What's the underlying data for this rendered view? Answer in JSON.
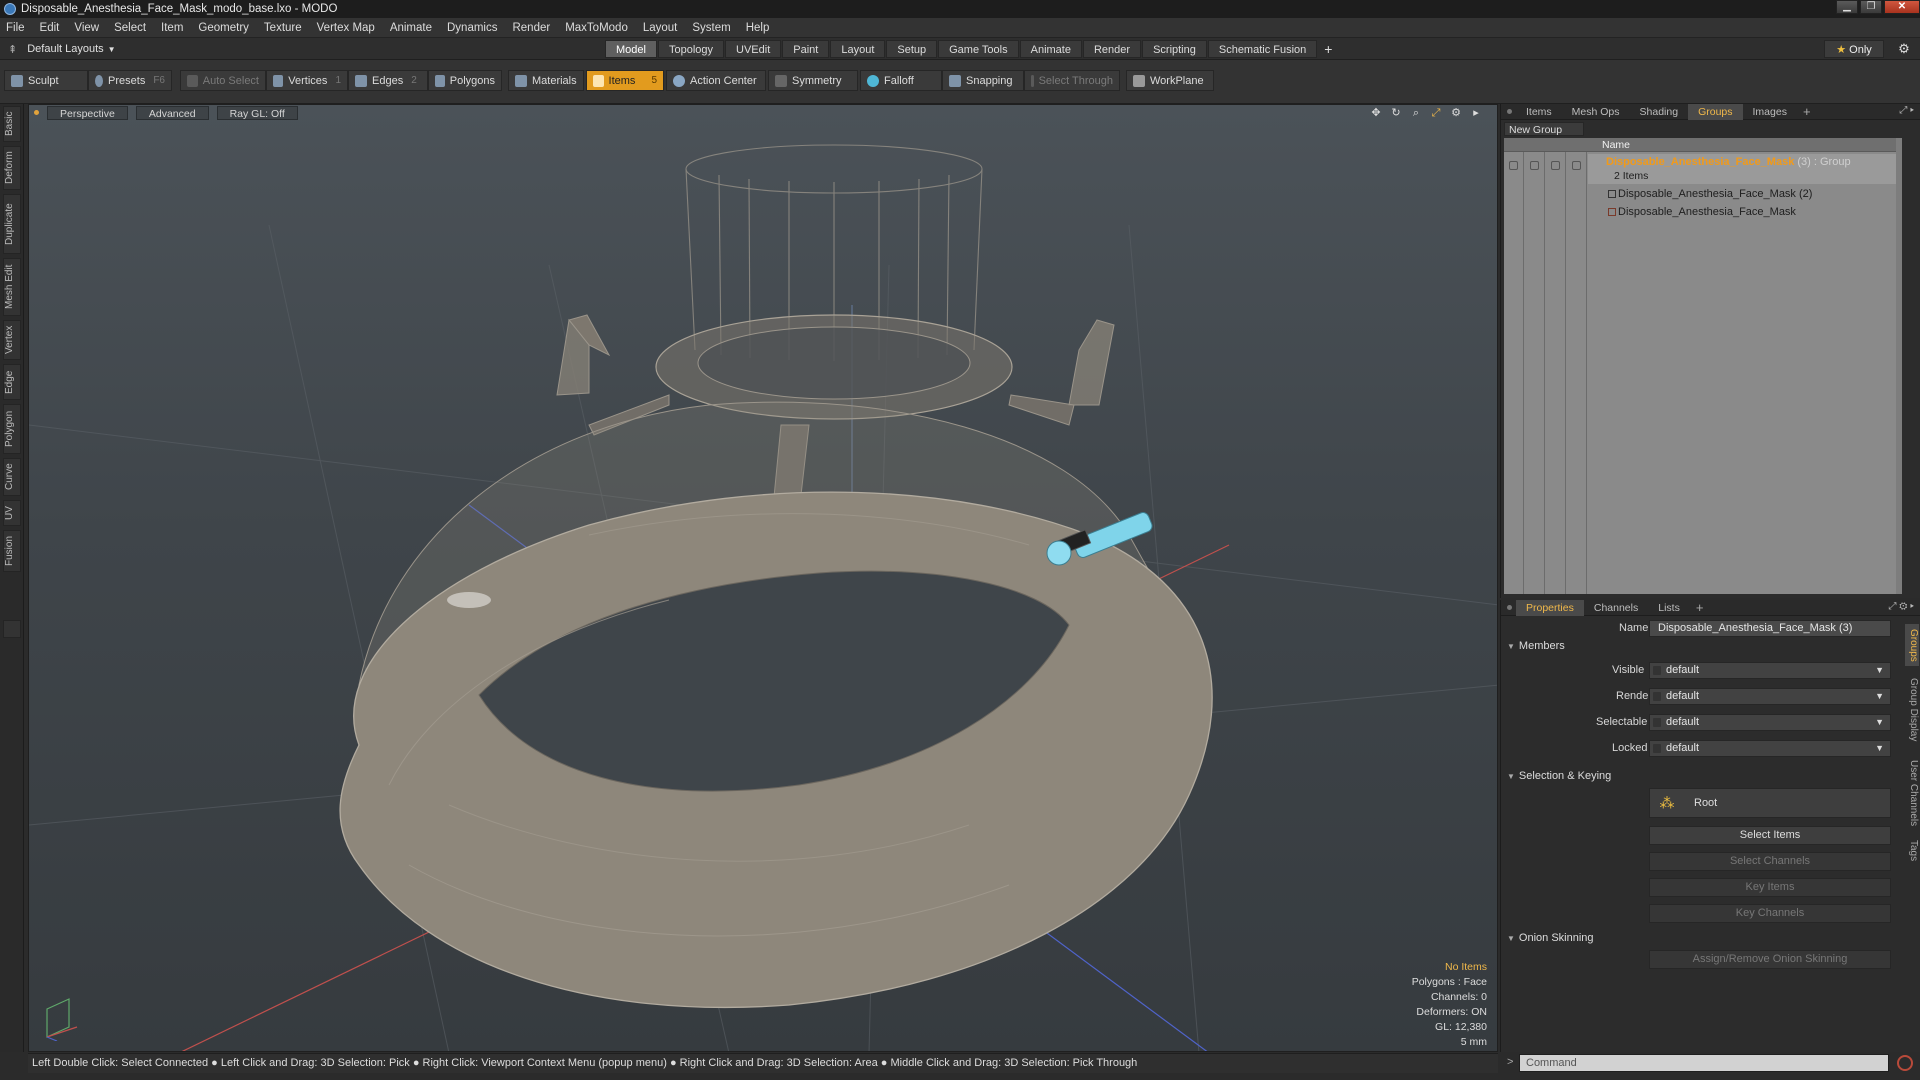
{
  "window": {
    "title": "Disposable_Anesthesia_Face_Mask_modo_base.lxo - MODO",
    "buttons": [
      "▁",
      "❐",
      "✕"
    ]
  },
  "menubar": [
    "File",
    "Edit",
    "View",
    "Select",
    "Item",
    "Geometry",
    "Texture",
    "Vertex Map",
    "Animate",
    "Dynamics",
    "Render",
    "MaxToModo",
    "Layout",
    "System",
    "Help"
  ],
  "modebar": {
    "layout_selector": "Default Layouts",
    "tabs": [
      "Model",
      "Topology",
      "UVEdit",
      "Paint",
      "Layout",
      "Setup",
      "Game Tools",
      "Animate",
      "Render",
      "Scripting",
      "Schematic Fusion"
    ],
    "active_tab": "Model",
    "add_tab": "+",
    "only_label": "Only",
    "only_star": "★"
  },
  "toolbar": {
    "sculpt": "Sculpt",
    "presets": "Presets",
    "presets_key": "F6",
    "auto_select": "Auto Select",
    "vertices": "Vertices",
    "vertices_count": "1",
    "edges": "Edges",
    "edges_count": "2",
    "polygons": "Polygons",
    "materials": "Materials",
    "items": "Items",
    "items_count": "5",
    "action_center": "Action Center",
    "symmetry": "Symmetry",
    "falloff": "Falloff",
    "snapping": "Snapping",
    "select_through": "Select Through",
    "workplane": "WorkPlane"
  },
  "left_tabs": [
    "Basic",
    "Deform",
    "Duplicate",
    "Mesh Edit",
    "Vertex",
    "Edge",
    "Polygon",
    "Curve",
    "UV",
    "Fusion"
  ],
  "viewport": {
    "view_mode": "Perspective",
    "advanced": "Advanced",
    "raygl": "Ray GL: Off",
    "stats": {
      "no_items": "No Items",
      "polygons": "Polygons : Face",
      "channels": "Channels: 0",
      "deformers": "Deformers: ON",
      "gl": "GL: 12,380",
      "unit": "5 mm"
    }
  },
  "statusbar": "Left Double Click: Select Connected ● Left Click and Drag: 3D Selection: Pick ● Right Click: Viewport Context Menu (popup menu) ● Right Click and Drag: 3D Selection: Area ● Middle Click and Drag: 3D Selection: Pick Through",
  "top_panel": {
    "tabs": [
      "Items",
      "Mesh Ops",
      "Shading",
      "Groups",
      "Images"
    ],
    "active_tab": "Groups",
    "add": "+",
    "new_group": "New Group",
    "name_header": "Name",
    "group": {
      "name": "Disposable_Anesthesia_Face_Mask",
      "count": " (3)",
      "type": " : Group",
      "items_label": "2 Items"
    },
    "items": [
      "Disposable_Anesthesia_Face_Mask (2)",
      "Disposable_Anesthesia_Face_Mask"
    ]
  },
  "bottom_panel": {
    "tabs": [
      "Properties",
      "Channels",
      "Lists"
    ],
    "active_tab": "Properties",
    "add": "+",
    "name_label": "Name",
    "name_value": "Disposable_Anesthesia_Face_Mask (3)",
    "members_section": "Members",
    "visible_label": "Visible",
    "visible_value": "default",
    "render_label": "Render",
    "render_value": "default",
    "selectable_label": "Selectable",
    "selectable_value": "default",
    "locked_label": "Locked",
    "locked_value": "default",
    "selection_section": "Selection & Keying",
    "root_label": "Root",
    "select_items": "Select Items",
    "select_channels": "Select Channels",
    "key_items": "Key Items",
    "key_channels": "Key Channels",
    "onion_section": "Onion Skinning",
    "onion_button": "Assign/Remove Onion Skinning",
    "side_tabs": [
      "Groups",
      "Group Display",
      "User Channels",
      "Tags"
    ],
    "command_placeholder": "Command"
  },
  "colors": {
    "accent": "#e29b1e",
    "group_name": "#f19a1a",
    "viewport_bg": "#3f454a",
    "mesh": "#8e877b"
  }
}
